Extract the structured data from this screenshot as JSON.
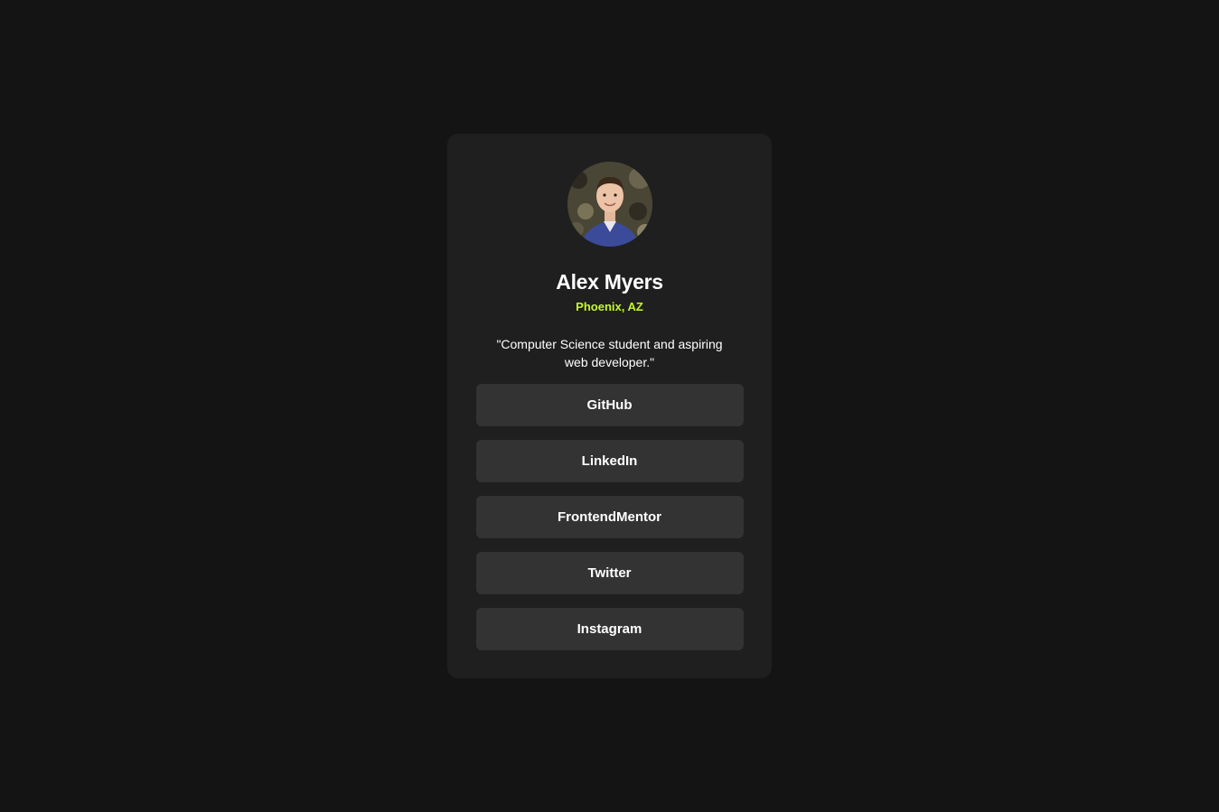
{
  "profile": {
    "avatar_alt": "Profile photo",
    "name": "Alex Myers",
    "location": "Phoenix, AZ",
    "bio": "\"Computer Science student and aspiring web developer.\""
  },
  "links": [
    {
      "label": "GitHub"
    },
    {
      "label": "LinkedIn"
    },
    {
      "label": "FrontendMentor"
    },
    {
      "label": "Twitter"
    },
    {
      "label": "Instagram"
    }
  ],
  "colors": {
    "background": "#141414",
    "card": "#1f1f1f",
    "button": "#333333",
    "accent": "#c4f82a",
    "text": "#ffffff"
  }
}
